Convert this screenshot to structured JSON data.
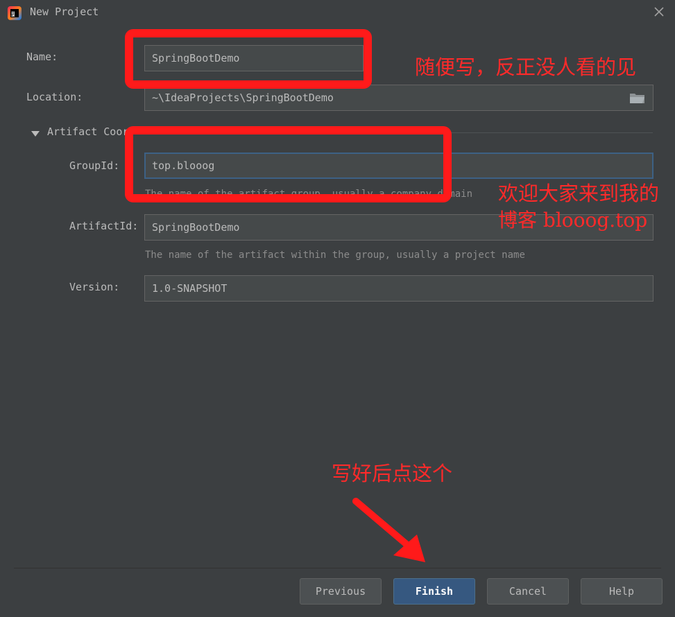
{
  "window": {
    "title": "New Project",
    "app_icon": "intellij-idea-icon",
    "close_icon": "close-icon"
  },
  "form": {
    "name_label": "Name:",
    "name_value": "SpringBootDemo",
    "location_label": "Location:",
    "location_value": "~\\IdeaProjects\\SpringBootDemo",
    "browse_icon": "folder-icon",
    "section_title": "Artifact Coor",
    "groupid_label": "GroupId:",
    "groupid_value": "top.blooog",
    "groupid_hint": "The name of the artifact group, usually a company domain",
    "artifactid_label": "ArtifactId:",
    "artifactid_value": "SpringBootDemo",
    "artifactid_hint": "The name of the artifact within the group, usually a project name",
    "version_label": "Version:",
    "version_value": "1.0-SNAPSHOT"
  },
  "buttons": {
    "previous": "Previous",
    "finish": "Finish",
    "cancel": "Cancel",
    "help": "Help"
  },
  "annotations": {
    "note_name": "随便写，反正没人看的见",
    "note_group_line1": "欢迎大家来到我的",
    "note_group_line2": "博客 blooog.top",
    "note_finish": "写好后点这个",
    "color": "#ff1a1a"
  }
}
